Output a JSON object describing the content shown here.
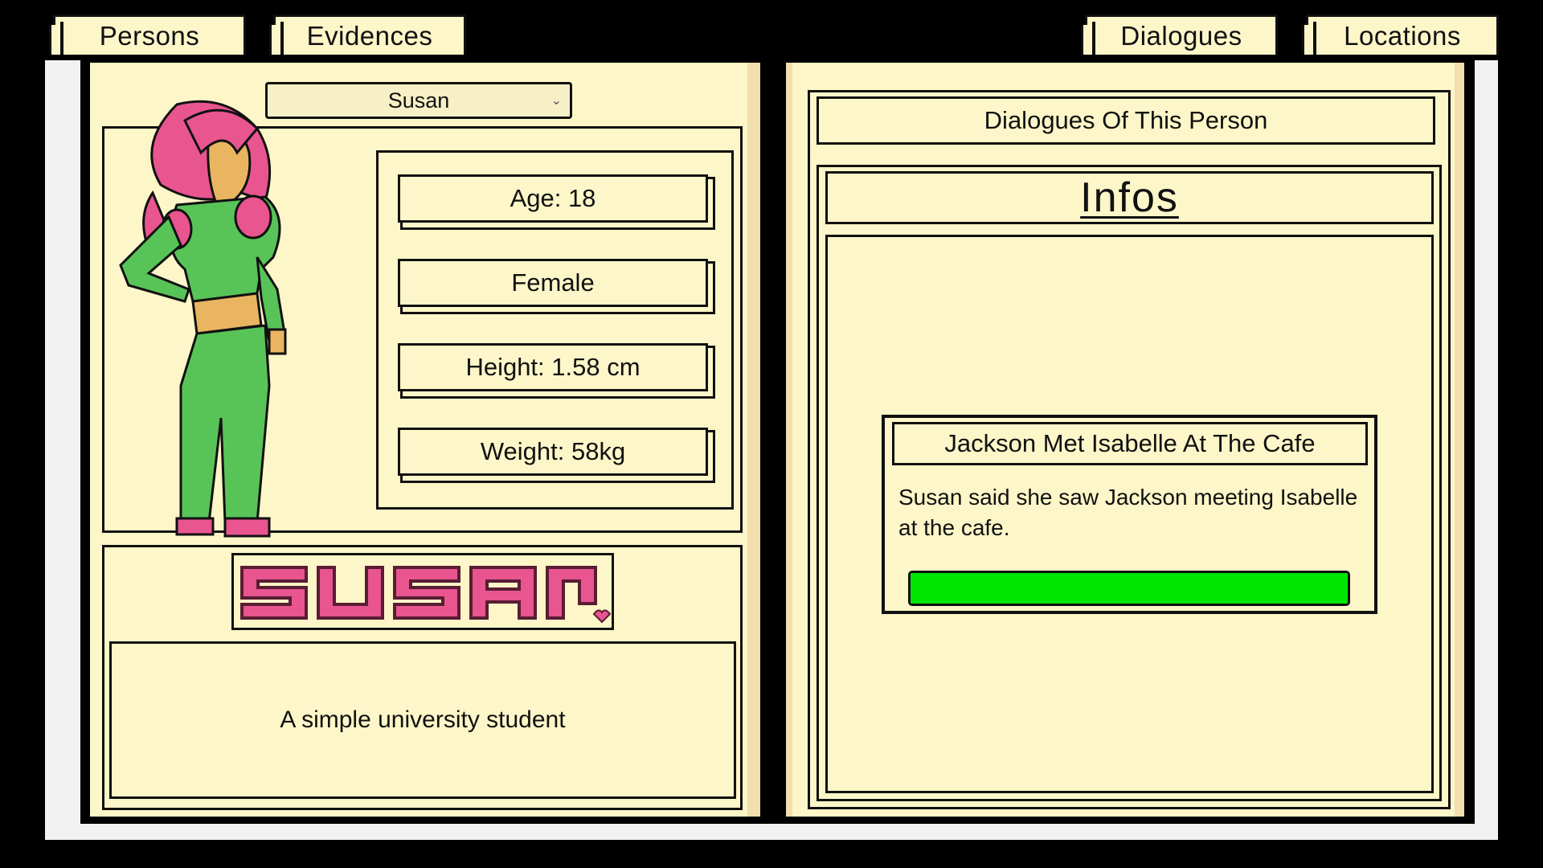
{
  "tabs": {
    "persons": "Persons",
    "evidences": "Evidences",
    "dialogues": "Dialogues",
    "locations": "Locations"
  },
  "person": {
    "selected_name": "Susan",
    "nameplate_logo": "SUSAN",
    "stats": {
      "age": "Age: 18",
      "gender": "Female",
      "height": "Height: 1.58 cm",
      "weight": "Weight: 58kg"
    },
    "description": "A simple university student"
  },
  "right_page": {
    "header": "Dialogues Of This Person",
    "infos_title": "Infos",
    "dialogue": {
      "title": "Jackson Met Isabelle At The Cafe",
      "text": "Susan said she saw Jackson meeting Isabelle at the cafe.",
      "progress": 1.0
    }
  },
  "colors": {
    "paper": "#fdf6c8",
    "progress": "#00e600",
    "hair": "#e8558f",
    "outfit": "#58c458"
  }
}
